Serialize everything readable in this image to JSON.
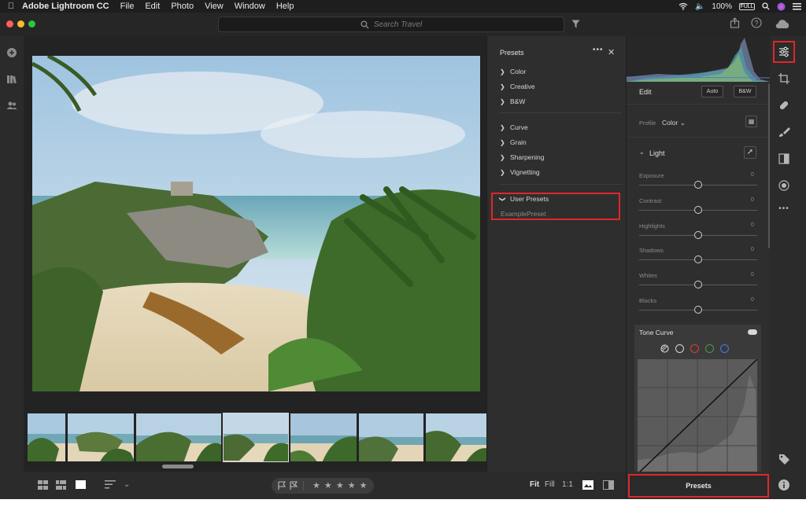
{
  "menubar": {
    "app_name": "Adobe Lightroom CC",
    "menus": [
      "File",
      "Edit",
      "Photo",
      "View",
      "Window",
      "Help"
    ],
    "battery": "100%",
    "battery_icon_text": "FULL"
  },
  "titlebar": {
    "search_placeholder": "Search Travel"
  },
  "presets_panel": {
    "title": "Presets",
    "more": "•••",
    "close": "✕",
    "groups_top": [
      "Color",
      "Creative",
      "B&W"
    ],
    "groups_mid": [
      "Curve",
      "Grain",
      "Sharpening",
      "Vignetting"
    ],
    "user_group": "User Presets",
    "user_preset": "ExamplePreset"
  },
  "edit_panel": {
    "title": "Edit",
    "auto_label": "Auto",
    "bw_label": "B&W",
    "profile_label": "Profile",
    "profile_value": "Color",
    "light_title": "Light",
    "sliders": [
      {
        "label": "Exposure",
        "value": "0"
      },
      {
        "label": "Contrast",
        "value": "0"
      },
      {
        "label": "Highlights",
        "value": "0"
      },
      {
        "label": "Shadows",
        "value": "0"
      },
      {
        "label": "Whites",
        "value": "0"
      },
      {
        "label": "Blacks",
        "value": "0"
      }
    ],
    "tone_curve_title": "Tone Curve"
  },
  "bottom_bar": {
    "fit": "Fit",
    "fill": "Fill",
    "one_to_one": "1:1",
    "stars": "★ ★ ★ ★ ★"
  },
  "presets_button": {
    "label": "Presets"
  },
  "colors": {
    "accent_red": "#e0262b",
    "panel_bg": "#2e2e2e",
    "app_bg": "#2b2b2b"
  }
}
